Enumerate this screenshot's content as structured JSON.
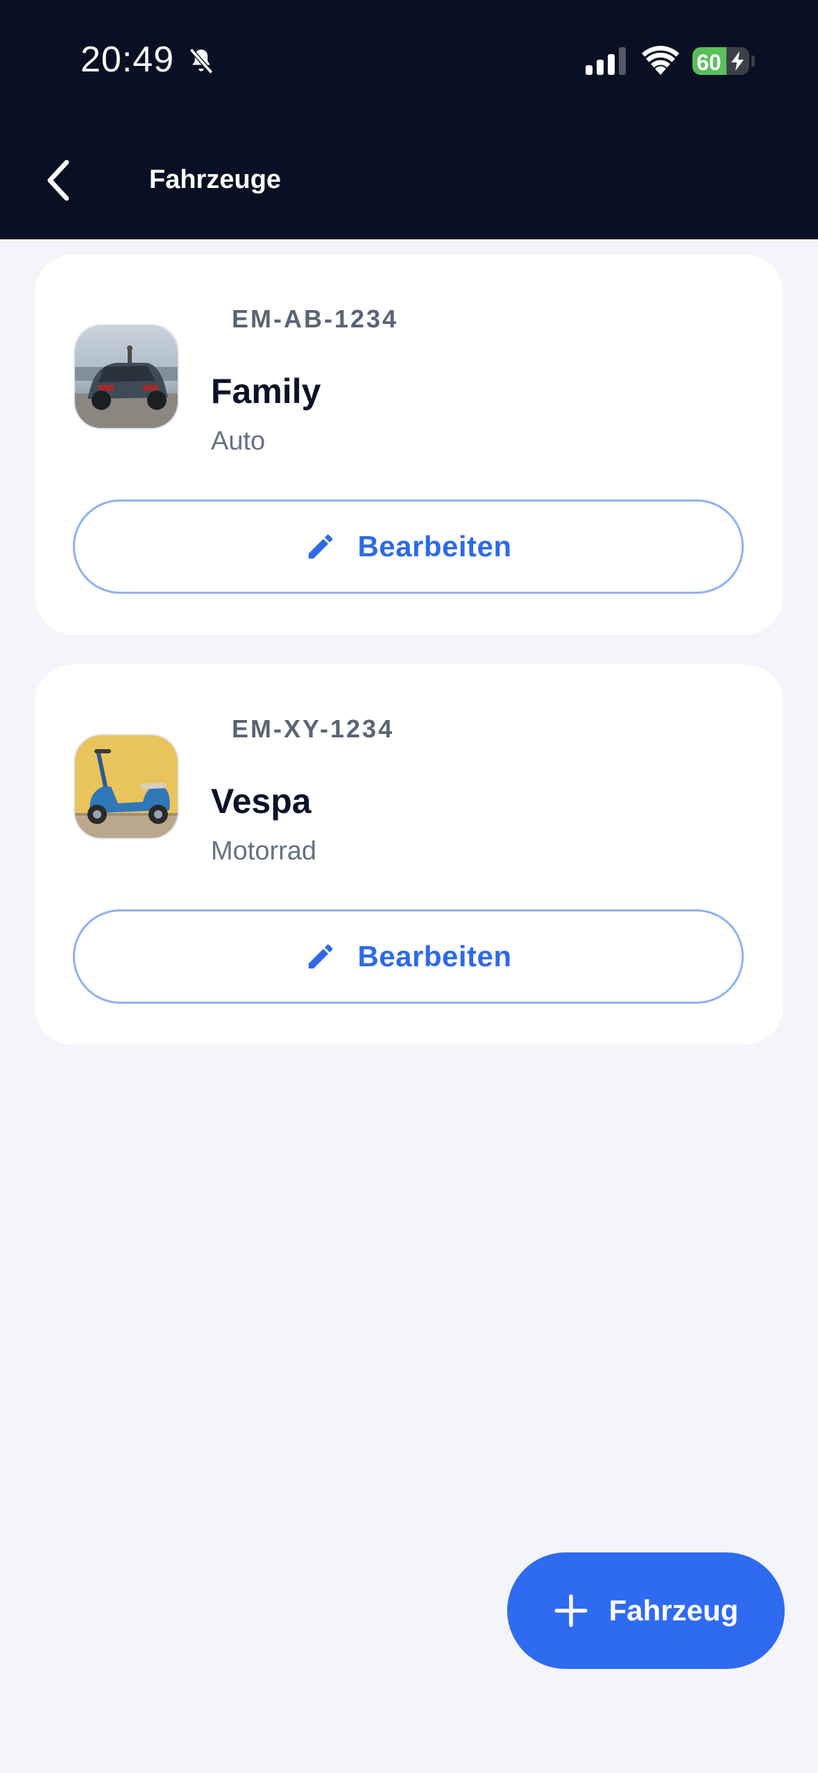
{
  "status_bar": {
    "time": "20:49",
    "battery_percent": "60",
    "battery_level": 0.6,
    "icons": [
      "bell-slash-icon",
      "cellular-signal-icon",
      "wifi-icon",
      "battery-charging-icon"
    ]
  },
  "header": {
    "title": "Fahrzeuge",
    "back_icon": "chevron-left-icon"
  },
  "vehicles": [
    {
      "plate": "EM-AB-1234",
      "name": "Family",
      "type": "Auto",
      "edit_label": "Bearbeiten",
      "edit_icon": "pencil-icon",
      "image": "car-photo"
    },
    {
      "plate": "EM-XY-1234",
      "name": "Vespa",
      "type": "Motorrad",
      "edit_label": "Bearbeiten",
      "edit_icon": "pencil-icon",
      "image": "scooter-photo"
    }
  ],
  "fab": {
    "label": "Fahrzeug",
    "icon": "plus-icon"
  },
  "colors": {
    "header_bg": "#0a1023",
    "page_bg": "#f3f5fa",
    "accent": "#2f6bf0",
    "button_border": "#8fb0f5",
    "battery_green": "#58c05a"
  }
}
